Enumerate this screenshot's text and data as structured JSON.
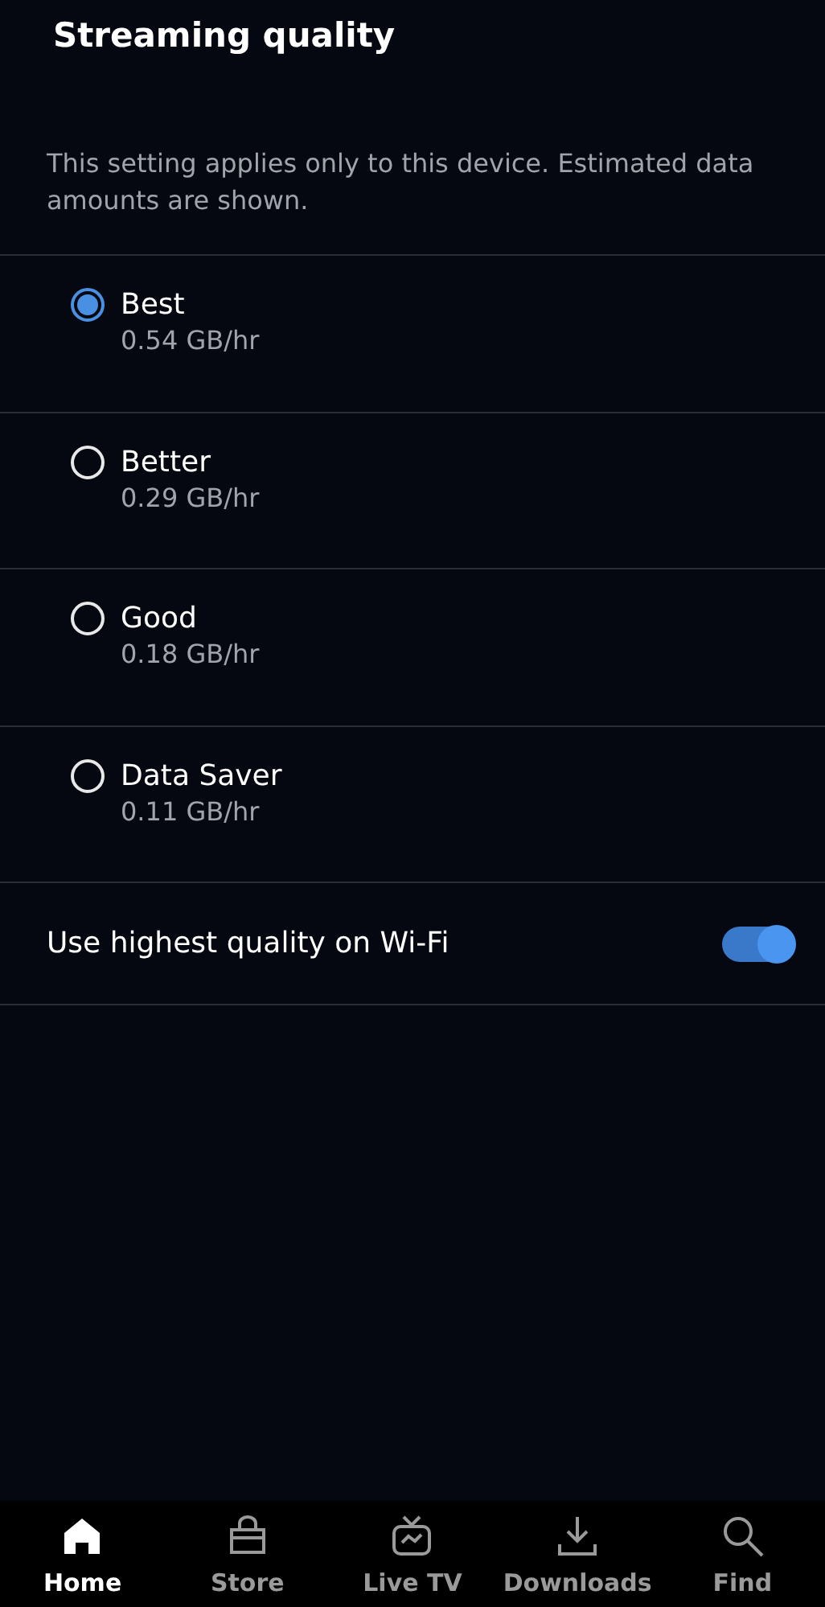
{
  "title": "Streaming quality",
  "description": "This setting applies only to this device. Estimated data amounts are shown.",
  "options": [
    {
      "label": "Best",
      "detail": "0.54 GB/hr",
      "selected": true
    },
    {
      "label": "Better",
      "detail": "0.29 GB/hr",
      "selected": false
    },
    {
      "label": "Good",
      "detail": "0.18 GB/hr",
      "selected": false
    },
    {
      "label": "Data Saver",
      "detail": "0.11 GB/hr",
      "selected": false
    }
  ],
  "wifi_setting": {
    "label": "Use highest quality on Wi-Fi",
    "on": true
  },
  "nav": [
    {
      "kind": "home",
      "label": "Home",
      "selected": true
    },
    {
      "kind": "store",
      "label": "Store",
      "selected": false
    },
    {
      "kind": "livetv",
      "label": "Live TV",
      "selected": false
    },
    {
      "kind": "downloads",
      "label": "Downloads",
      "selected": false
    },
    {
      "kind": "find",
      "label": "Find",
      "selected": false
    }
  ]
}
